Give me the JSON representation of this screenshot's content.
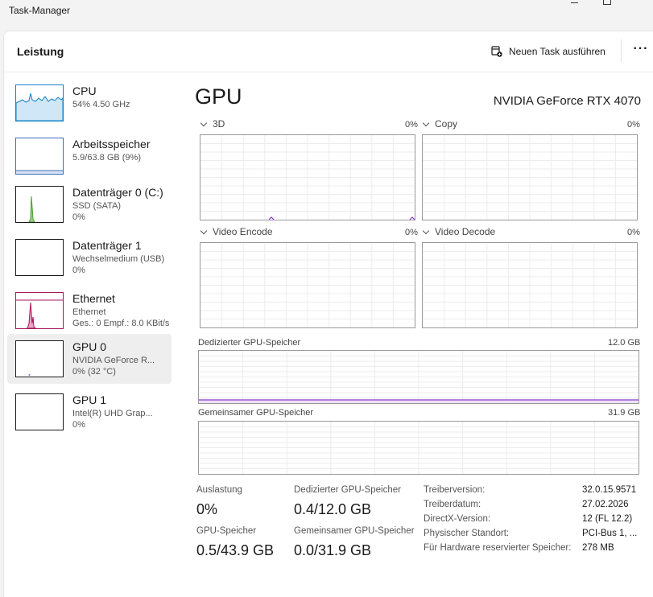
{
  "window": {
    "title": "Task-Manager"
  },
  "header": {
    "title": "Leistung",
    "run_task_label": "Neuen Task ausführen",
    "more_label": "···"
  },
  "sidebar": {
    "items": [
      {
        "title": "CPU",
        "sub1": "54%  4.50 GHz",
        "sub2": "",
        "color": "#1182c8"
      },
      {
        "title": "Arbeitsspeicher",
        "sub1": "5.9/63.8 GB (9%)",
        "sub2": "",
        "color": "#3b6fb6"
      },
      {
        "title": "Datenträger 0 (C:)",
        "sub1": "SSD (SATA)",
        "sub2": "0%",
        "color": "#4a9d2c"
      },
      {
        "title": "Datenträger 1",
        "sub1": "Wechselmedium (USB)",
        "sub2": "0%",
        "color": "#4a9d2c"
      },
      {
        "title": "Ethernet",
        "sub1": "Ethernet",
        "sub2": "Ges.: 0 Empf.: 8.0 KBit/s",
        "color": "#a7185c"
      },
      {
        "title": "GPU 0",
        "sub1": "NVIDIA GeForce R...",
        "sub2": "0%  (32 °C)",
        "color": "#8a3ad0"
      },
      {
        "title": "GPU 1",
        "sub1": "Intel(R) UHD Grap...",
        "sub2": "0%",
        "color": "#8a3ad0"
      }
    ],
    "selected_index": 5
  },
  "main": {
    "title": "GPU",
    "model": "NVIDIA GeForce RTX 4070",
    "engines": [
      {
        "name": "3D",
        "pct": "0%"
      },
      {
        "name": "Copy",
        "pct": "0%"
      },
      {
        "name": "Video Encode",
        "pct": "0%"
      },
      {
        "name": "Video Decode",
        "pct": "0%"
      }
    ],
    "dedicated_mem": {
      "label": "Dedizierter GPU-Speicher",
      "max": "12.0 GB"
    },
    "shared_mem": {
      "label": "Gemeinsamer GPU-Speicher",
      "max": "31.9 GB"
    },
    "stats": {
      "usage_label": "Auslastung",
      "usage_value": "0%",
      "dedicated_label": "Dedizierter GPU-Speicher",
      "dedicated_value": "0.4/12.0 GB",
      "gpu_mem_label": "GPU-Speicher",
      "gpu_mem_value": "0.5/43.9 GB",
      "shared_label": "Gemeinsamer GPU-Speicher",
      "shared_value": "0.0/31.9 GB"
    },
    "info": [
      {
        "key": "Treiberversion:",
        "value": "32.0.15.9571"
      },
      {
        "key": "Treiberdatum:",
        "value": "27.02.2026"
      },
      {
        "key": "DirectX-Version:",
        "value": "12 (FL 12.2)"
      },
      {
        "key": "Physischer Standort:",
        "value": "PCI-Bus 1, ..."
      },
      {
        "key": "Für Hardware reservierter Speicher:",
        "value": "278 MB"
      }
    ],
    "accent_color": "#8a3ad0"
  }
}
